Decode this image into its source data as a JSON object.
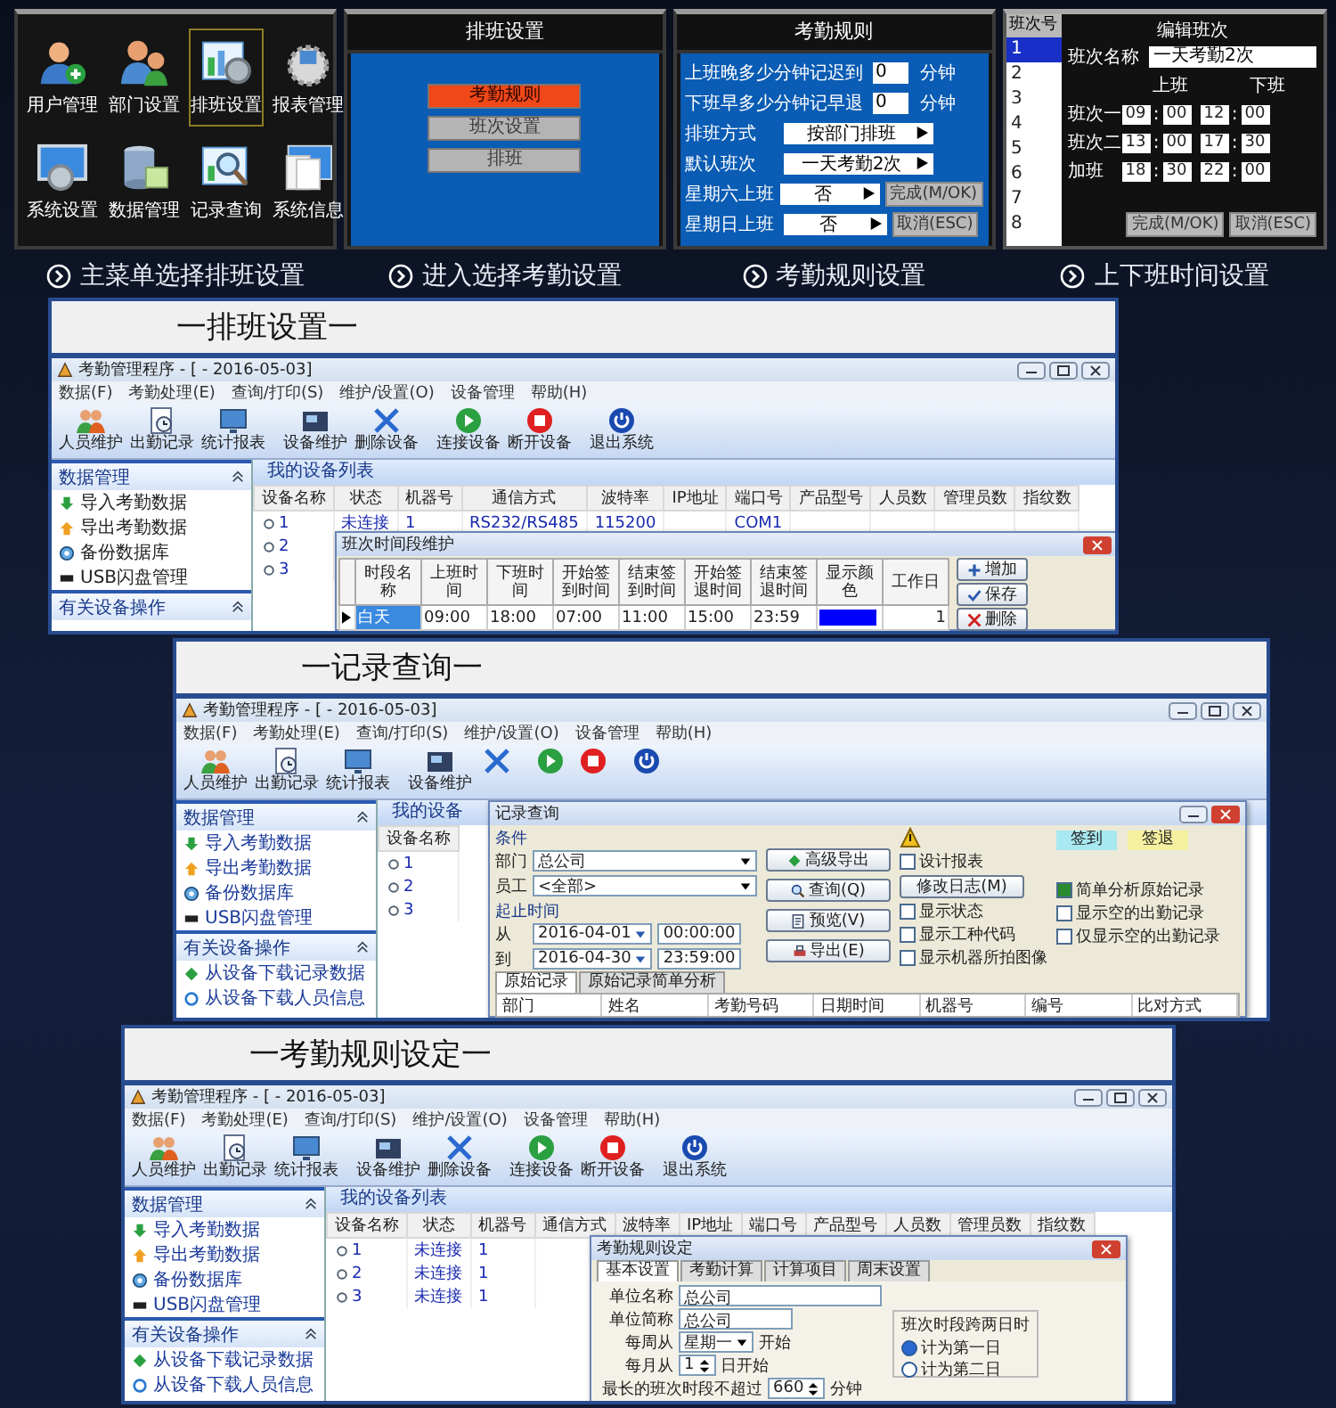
{
  "main_menu": {
    "items": [
      {
        "label": "用户管理",
        "kind": "user-add",
        "selected": false
      },
      {
        "label": "部门设置",
        "kind": "users",
        "selected": false
      },
      {
        "label": "排班设置",
        "kind": "schedule",
        "selected": true
      },
      {
        "label": "报表管理",
        "kind": "report",
        "selected": false
      },
      {
        "label": "系统设置",
        "kind": "system",
        "selected": false
      },
      {
        "label": "数据管理",
        "kind": "database",
        "selected": false
      },
      {
        "label": "记录查询",
        "kind": "search",
        "selected": false
      },
      {
        "label": "系统信息",
        "kind": "info",
        "selected": false
      }
    ],
    "caption": "主菜单选择排班设置"
  },
  "schedule_menu": {
    "title": "排班设置",
    "options": [
      {
        "label": "考勤规则",
        "selected": true
      },
      {
        "label": "班次设置",
        "selected": false
      },
      {
        "label": "排班",
        "selected": false
      }
    ],
    "caption": "进入选择考勤设置"
  },
  "attendance_rules": {
    "title": "考勤规则",
    "rows": [
      {
        "label": "上班晚多少分钟记迟到",
        "kind": "number",
        "value": "0",
        "unit": "分钟"
      },
      {
        "label": "下班早多少分钟记早退",
        "kind": "number",
        "value": "0",
        "unit": "分钟"
      },
      {
        "label": "排班方式",
        "kind": "select",
        "value": "按部门排班"
      },
      {
        "label": "默认班次",
        "kind": "select",
        "value": "一天考勤2次"
      },
      {
        "label": "星期六上班",
        "kind": "select",
        "value": "否",
        "button": "完成(M/OK)"
      },
      {
        "label": "星期日上班",
        "kind": "select",
        "value": "否",
        "button": "取消(ESC)"
      }
    ],
    "caption": "考勤规则设置"
  },
  "shift_edit": {
    "list_header": "班次号",
    "shifts": [
      {
        "label": "1",
        "selected": true
      },
      {
        "label": "2",
        "selected": false
      },
      {
        "label": "3",
        "selected": false
      },
      {
        "label": "4",
        "selected": false
      },
      {
        "label": "5",
        "selected": false
      },
      {
        "label": "6",
        "selected": false
      },
      {
        "label": "7",
        "selected": false
      },
      {
        "label": "8",
        "selected": false
      }
    ],
    "title": "编辑班次",
    "name_label": "班次名称",
    "name_value": "一天考勤2次",
    "on_label": "上班",
    "off_label": "下班",
    "separator": ":",
    "rows": [
      {
        "label": "班次一",
        "times": [
          "09",
          "00",
          "12",
          "00"
        ]
      },
      {
        "label": "班次二",
        "times": [
          "13",
          "00",
          "17",
          "30"
        ]
      },
      {
        "label": "加班",
        "times": [
          "18",
          "30",
          "22",
          "00"
        ]
      }
    ],
    "buttons": [
      "完成(M/OK)",
      "取消(ESC)"
    ],
    "caption": "上下班时间设置"
  },
  "cards": [
    {
      "title": "一排班设置一",
      "window": {
        "title": "考勤管理程序 - [ - 2016-05-03]",
        "menu": [
          "数据(F)",
          "考勤处理(E)",
          "查询/打印(S)",
          "维护/设置(O)",
          "设备管理",
          "帮助(H)"
        ],
        "toolbar": [
          {
            "kind": "people",
            "label": "人员维护"
          },
          {
            "kind": "record",
            "label": "出勤记录"
          },
          {
            "kind": "report",
            "label": "统计报表"
          },
          {
            "kind": "device",
            "label": "设备维护"
          },
          {
            "kind": "delete",
            "label": "删除设备"
          },
          {
            "kind": "connect",
            "label": "连接设备"
          },
          {
            "kind": "disconnect",
            "label": "断开设备"
          },
          {
            "kind": "exit",
            "label": "退出系统"
          }
        ],
        "sidebar": [
          {
            "title": "数据管理",
            "items": [
              {
                "kind": "import",
                "label": "导入考勤数据"
              },
              {
                "kind": "export",
                "label": "导出考勤数据"
              },
              {
                "kind": "backup",
                "label": "备份数据库"
              },
              {
                "kind": "usb",
                "label": "USB闪盘管理"
              }
            ]
          },
          {
            "title": "有关设备操作"
          }
        ],
        "tab": "我的设备列表",
        "columns": [
          "设备名称",
          "状态",
          "机器号",
          "通信方式",
          "波特率",
          "IP地址",
          "端口号",
          "产品型号",
          "人员数",
          "管理员数",
          "指纹数"
        ],
        "rows": [
          {
            "name": "1",
            "status": "未连接",
            "machine": "1",
            "comm": "RS232/RS485",
            "baud": "115200",
            "port": "COM1"
          },
          {
            "name": "2"
          },
          {
            "name": "3"
          }
        ]
      },
      "dialog": {
        "kind": "shift_table",
        "title": "班次时间段维护",
        "columns": [
          "时段名称",
          "上班时间",
          "下班时间",
          "开始签到时间",
          "结束签到时间",
          "开始签退时间",
          "结束签退时间",
          "显示颜色",
          "工作日"
        ],
        "row": {
          "cells": [
            "白天",
            "09:00",
            "18:00",
            "07:00",
            "11:00",
            "15:00",
            "23:59"
          ],
          "color": "#0000ff",
          "workdays": "1"
        },
        "buttons": [
          {
            "kind": "add",
            "label": "增加"
          },
          {
            "kind": "save",
            "label": "保存"
          },
          {
            "kind": "delete",
            "label": "删除"
          }
        ]
      }
    },
    {
      "title": "一记录查询一",
      "window": {
        "title": "考勤管理程序 - [ - 2016-05-03]",
        "menu": [
          "数据(F)",
          "考勤处理(E)",
          "查询/打印(S)",
          "维护/设置(O)",
          "设备管理",
          "帮助(H)"
        ],
        "toolbar": [
          {
            "kind": "people",
            "label": "人员维护"
          },
          {
            "kind": "record",
            "label": "出勤记录"
          },
          {
            "kind": "report",
            "label": "统计报表"
          },
          {
            "kind": "device",
            "label": "设备维护"
          },
          {
            "kind": "delete"
          },
          {
            "kind": "connect"
          },
          {
            "kind": "disconnect"
          },
          {
            "kind": "exit"
          }
        ],
        "sidebar": [
          {
            "title": "数据管理",
            "items": [
              {
                "kind": "import",
                "label": "导入考勤数据"
              },
              {
                "kind": "export",
                "label": "导出考勤数据"
              },
              {
                "kind": "backup",
                "label": "备份数据库"
              },
              {
                "kind": "usb",
                "label": "USB闪盘管理"
              }
            ]
          },
          {
            "title": "有关设备操作",
            "items": [
              {
                "kind": "download",
                "label": "从设备下载记录数据"
              },
              {
                "kind": "download-user",
                "label": "从设备下载人员信息"
              }
            ]
          }
        ],
        "tab": "我的设备",
        "columns": [
          "设备名称"
        ],
        "rows": [
          {
            "name": "1"
          },
          {
            "name": "2"
          },
          {
            "name": "3"
          }
        ]
      },
      "dialog": {
        "kind": "record_query",
        "title": "记录查询",
        "group": "条件",
        "fields": [
          {
            "label": "部门",
            "value": "总公司"
          },
          {
            "label": "员工",
            "value": "<全部>"
          }
        ],
        "range_label": "起止时间",
        "range": [
          {
            "label": "从",
            "date": "2016-04-01",
            "time": "00:00:00"
          },
          {
            "label": "到",
            "date": "2016-04-30",
            "time": "23:59:00"
          }
        ],
        "buttons": [
          {
            "kind": "export",
            "label": "高级导出"
          },
          {
            "kind": "search",
            "label": "查询(Q)"
          },
          {
            "kind": "preview",
            "label": "预览(V)"
          },
          {
            "kind": "print",
            "label": "导出(E)"
          }
        ],
        "design": {
          "label": "设计报表",
          "checked": false
        },
        "log_button": "修改日志(M)",
        "legend": [
          {
            "label": "签到",
            "color": "#a8e8f0"
          },
          {
            "label": "签退",
            "color": "#f4f0a0"
          }
        ],
        "options_left": [
          {
            "label": "显示状态",
            "checked": false
          },
          {
            "label": "显示工种代码",
            "checked": false
          },
          {
            "label": "显示机器所拍图像",
            "checked": false
          }
        ],
        "options_right": [
          {
            "label": "简单分析原始记录",
            "checked": true
          },
          {
            "label": "显示空的出勤记录",
            "checked": false
          },
          {
            "label": "仅显示空的出勤记录",
            "checked": false
          }
        ],
        "tabs": [
          {
            "label": "原始记录",
            "selected": true
          },
          {
            "label": "原始记录简单分析",
            "selected": false
          }
        ],
        "columns": [
          "部门",
          "姓名",
          "考勤号码",
          "日期时间",
          "机器号",
          "编号",
          "比对方式"
        ]
      }
    },
    {
      "title": "一考勤规则设定一",
      "window": {
        "title": "考勤管理程序 - [ - 2016-05-03]",
        "menu": [
          "数据(F)",
          "考勤处理(E)",
          "查询/打印(S)",
          "维护/设置(O)",
          "设备管理",
          "帮助(H)"
        ],
        "toolbar": [
          {
            "kind": "people",
            "label": "人员维护"
          },
          {
            "kind": "record",
            "label": "出勤记录"
          },
          {
            "kind": "report",
            "label": "统计报表"
          },
          {
            "kind": "device",
            "label": "设备维护"
          },
          {
            "kind": "delete",
            "label": "删除设备"
          },
          {
            "kind": "connect",
            "label": "连接设备"
          },
          {
            "kind": "disconnect",
            "label": "断开设备"
          },
          {
            "kind": "exit",
            "label": "退出系统"
          }
        ],
        "sidebar": [
          {
            "title": "数据管理",
            "items": [
              {
                "kind": "import",
                "label": "导入考勤数据"
              },
              {
                "kind": "export",
                "label": "导出考勤数据"
              },
              {
                "kind": "backup",
                "label": "备份数据库"
              },
              {
                "kind": "usb",
                "label": "USB闪盘管理"
              }
            ]
          },
          {
            "title": "有关设备操作",
            "items": [
              {
                "kind": "download",
                "label": "从设备下载记录数据"
              },
              {
                "kind": "download-user",
                "label": "从设备下载人员信息"
              }
            ]
          }
        ],
        "tab": "我的设备列表",
        "columns": [
          "设备名称",
          "状态",
          "机器号",
          "通信方式",
          "波特率",
          "IP地址",
          "端口号",
          "产品型号",
          "人员数",
          "管理员数",
          "指纹数"
        ],
        "rows": [
          {
            "name": "1",
            "status": "未连接",
            "machine": "1"
          },
          {
            "name": "2",
            "status": "未连接",
            "machine": "1"
          },
          {
            "name": "3",
            "status": "未连接",
            "machine": "1"
          }
        ]
      },
      "dialog": {
        "kind": "rules",
        "title": "考勤规则设定",
        "tabs": [
          {
            "label": "基本设置",
            "selected": true
          },
          {
            "label": "考勤计算",
            "selected": false
          },
          {
            "label": "计算项目",
            "selected": false
          },
          {
            "label": "周末设置",
            "selected": false
          }
        ],
        "fields": [
          {
            "label": "单位名称",
            "value": "总公司"
          },
          {
            "label": "单位简称",
            "value": "总公司"
          }
        ],
        "week": {
          "label": "每周从",
          "value": "星期一",
          "suffix": "开始"
        },
        "month": {
          "label": "每月从",
          "value": "1",
          "suffix": "日开始"
        },
        "group": {
          "title": "班次时段跨两日时",
          "options": [
            {
              "label": "计为第一日",
              "selected": true
            },
            {
              "label": "计为第二日",
              "selected": false
            }
          ]
        },
        "max": {
          "label": "最长的班次时段不超过",
          "value": "660",
          "suffix": "分钟"
        }
      }
    }
  ]
}
